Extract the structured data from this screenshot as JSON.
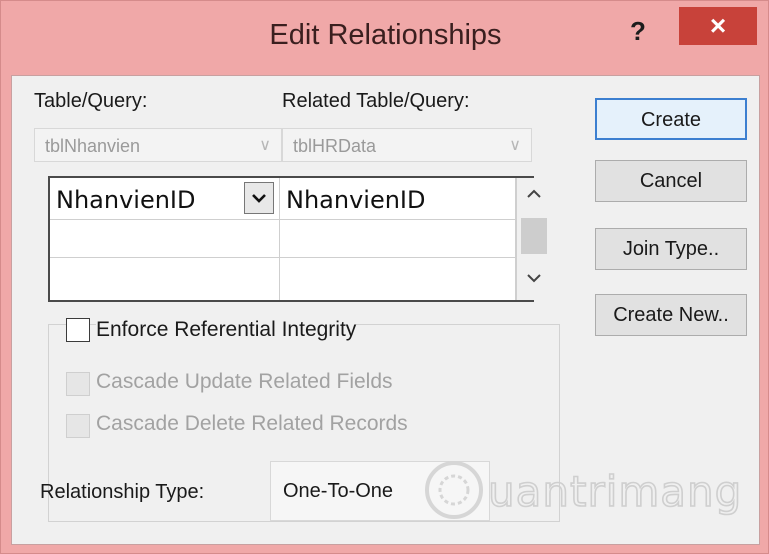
{
  "window": {
    "title": "Edit Relationships",
    "help_glyph": "?",
    "close_glyph": "×"
  },
  "labels": {
    "table_query": "Table/Query:",
    "related_table_query": "Related Table/Query:",
    "relationship_type": "Relationship Type:"
  },
  "combos": {
    "table": "tblNhanvien",
    "related_table": "tblHRData"
  },
  "field_grid": {
    "rows": [
      {
        "left": "NhanvienID",
        "right": "NhanvienID"
      },
      {
        "left": "",
        "right": ""
      },
      {
        "left": "",
        "right": ""
      }
    ]
  },
  "buttons": {
    "create": "Create",
    "cancel": "Cancel",
    "join_type": "Join Type..",
    "create_new": "Create New.."
  },
  "checkboxes": {
    "enforce": {
      "label": "Enforce Referential Integrity",
      "checked": false,
      "enabled": true
    },
    "cascade_update": {
      "label": "Cascade Update Related Fields",
      "checked": false,
      "enabled": false
    },
    "cascade_delete": {
      "label": "Cascade Delete Related Records",
      "checked": false,
      "enabled": false
    }
  },
  "relationship_type_value": "One-To-One",
  "watermark": "Quantrimang",
  "colors": {
    "title_bar": "#f0a8a8",
    "close_button": "#c8423a",
    "default_button_border": "#3c7fd0",
    "dialog_body": "#f0f0f0"
  }
}
